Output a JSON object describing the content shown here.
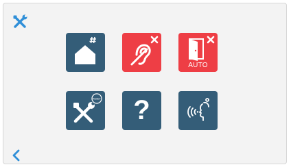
{
  "colors": {
    "tile_blue": "#345d78",
    "tile_red": "#ee3e45",
    "accent_blue": "#2f8fd8",
    "icon_white": "#ffffff"
  },
  "header": {
    "settings_icon": "tools-icon"
  },
  "menu": {
    "tiles": [
      {
        "name": "home-keypad",
        "icon": "house-hash-icon",
        "state": "normal"
      },
      {
        "name": "hearing-loop",
        "icon": "hearing-loop-icon",
        "state": "disabled"
      },
      {
        "name": "auto-door-open",
        "icon": "door-icon",
        "label": "AUTO",
        "state": "disabled"
      },
      {
        "name": "installer-settings",
        "icon": "tools-reset-icon",
        "state": "normal"
      },
      {
        "name": "help",
        "label": "?",
        "icon": "question-icon",
        "state": "normal"
      },
      {
        "name": "voice-settings",
        "icon": "voice-icon",
        "state": "normal"
      }
    ]
  },
  "footer": {
    "back_icon": "chevron-left-icon"
  }
}
